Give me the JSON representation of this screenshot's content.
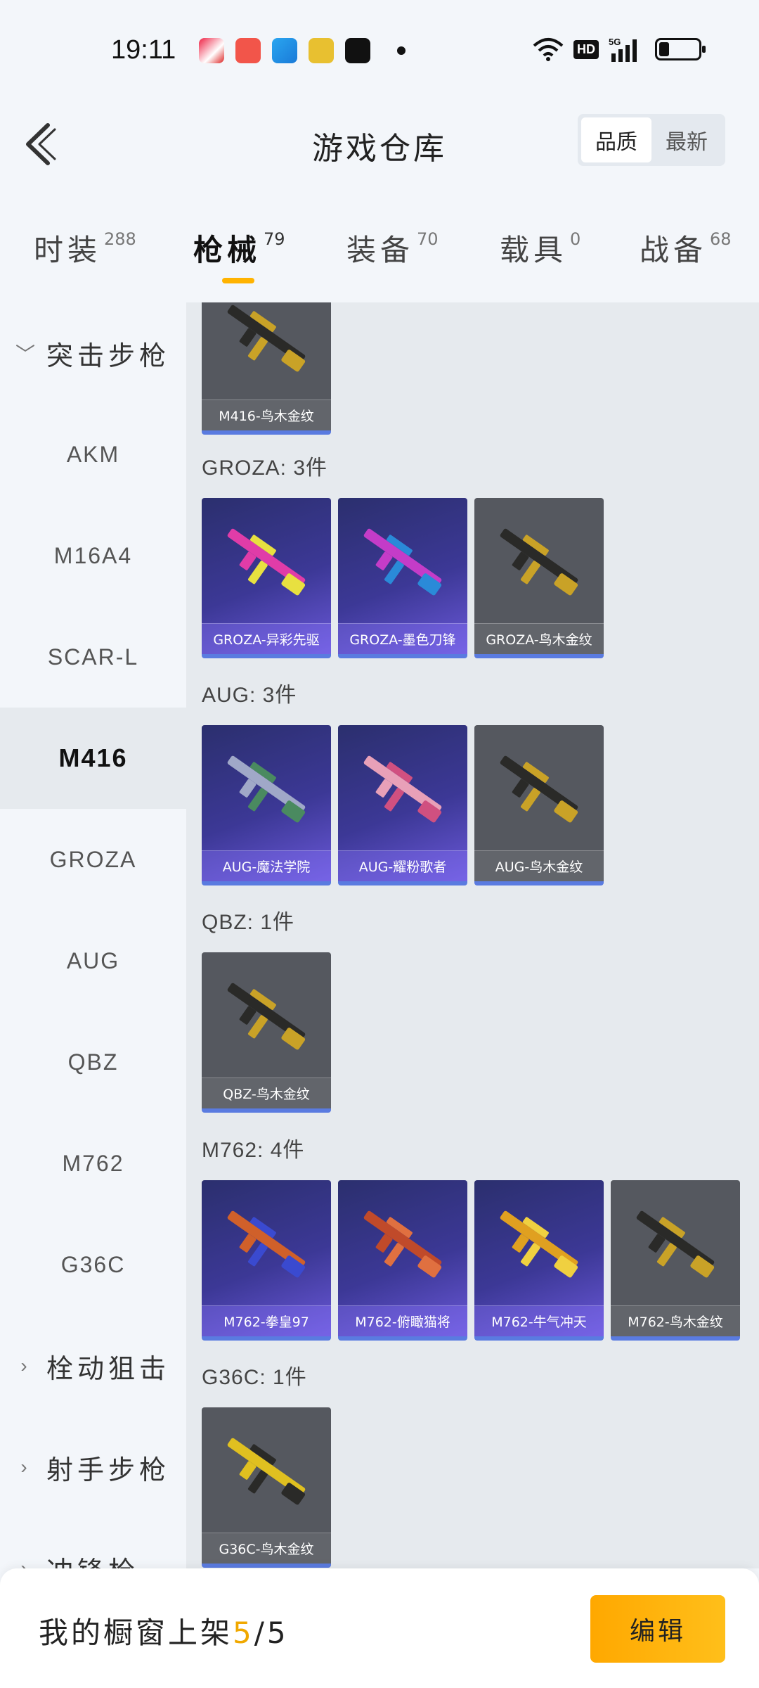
{
  "status_bar": {
    "time": "19:11",
    "app_icons": [
      "game-app-icon",
      "photo-app-icon",
      "send-app-icon",
      "camera-app-icon",
      "shop-app-icon"
    ],
    "network": "HD",
    "signal": "5G",
    "battery_level": 0.2
  },
  "header": {
    "title": "游戏仓库",
    "sort_options": [
      "品质",
      "最新"
    ],
    "sort_selected": "品质"
  },
  "tabs": [
    {
      "label": "时装",
      "count": "288"
    },
    {
      "label": "枪械",
      "count": "79",
      "active": true
    },
    {
      "label": "装备",
      "count": "70"
    },
    {
      "label": "载具",
      "count": "0"
    },
    {
      "label": "战备",
      "count": "68"
    }
  ],
  "sidebar": {
    "group_assault": "突击步枪",
    "items": [
      "AKM",
      "M16A4",
      "SCAR-L",
      "M416",
      "GROZA",
      "AUG",
      "QBZ",
      "M762",
      "G36C"
    ],
    "selected": "M416",
    "group_bolt": "栓动狙击",
    "group_marksman": "射手步枪",
    "group_next": "冲锋枪"
  },
  "sections": [
    {
      "title": "",
      "items": [
        {
          "name": "M416-鸟木金纹",
          "tier": "gray",
          "colors": [
            "#2a2a28",
            "#c9a227"
          ]
        }
      ]
    },
    {
      "title": "GROZA: 3件",
      "items": [
        {
          "name": "GROZA-异彩先驱",
          "tier": "purple",
          "colors": [
            "#e03ca8",
            "#e8e040"
          ]
        },
        {
          "name": "GROZA-墨色刀锋",
          "tier": "purple",
          "colors": [
            "#c43cc8",
            "#2a8ad8"
          ]
        },
        {
          "name": "GROZA-鸟木金纹",
          "tier": "gray",
          "colors": [
            "#2a2a28",
            "#c9a227"
          ]
        }
      ]
    },
    {
      "title": "AUG: 3件",
      "items": [
        {
          "name": "AUG-魔法学院",
          "tier": "purple",
          "colors": [
            "#a0a8c8",
            "#4a8a60"
          ]
        },
        {
          "name": "AUG-耀粉歌者",
          "tier": "purple",
          "colors": [
            "#e8a0b8",
            "#d05080"
          ]
        },
        {
          "name": "AUG-鸟木金纹",
          "tier": "gray",
          "colors": [
            "#2a2a28",
            "#c9a227"
          ]
        }
      ]
    },
    {
      "title": "QBZ: 1件",
      "items": [
        {
          "name": "QBZ-鸟木金纹",
          "tier": "gray",
          "colors": [
            "#2a2a28",
            "#c9a227"
          ]
        }
      ]
    },
    {
      "title": "M762: 4件",
      "items": [
        {
          "name": "M762-拳皇97",
          "tier": "purple",
          "colors": [
            "#d0602a",
            "#3a4ad0"
          ]
        },
        {
          "name": "M762-俯瞰猫将",
          "tier": "purple",
          "colors": [
            "#c04a2a",
            "#e07040"
          ]
        },
        {
          "name": "M762-牛气冲天",
          "tier": "purple",
          "colors": [
            "#e0a020",
            "#f0d040"
          ]
        },
        {
          "name": "M762-鸟木金纹",
          "tier": "gray",
          "colors": [
            "#2a2a28",
            "#c9a227"
          ]
        }
      ]
    },
    {
      "title": "G36C: 1件",
      "items": [
        {
          "name": "G36C-鸟木金纹",
          "tier": "gray",
          "colors": [
            "#e0c020",
            "#2a2a28"
          ]
        }
      ]
    }
  ],
  "bottom_bar": {
    "label": "我的橱窗上架",
    "current": "5",
    "total": "/5",
    "edit_label": "编辑"
  }
}
